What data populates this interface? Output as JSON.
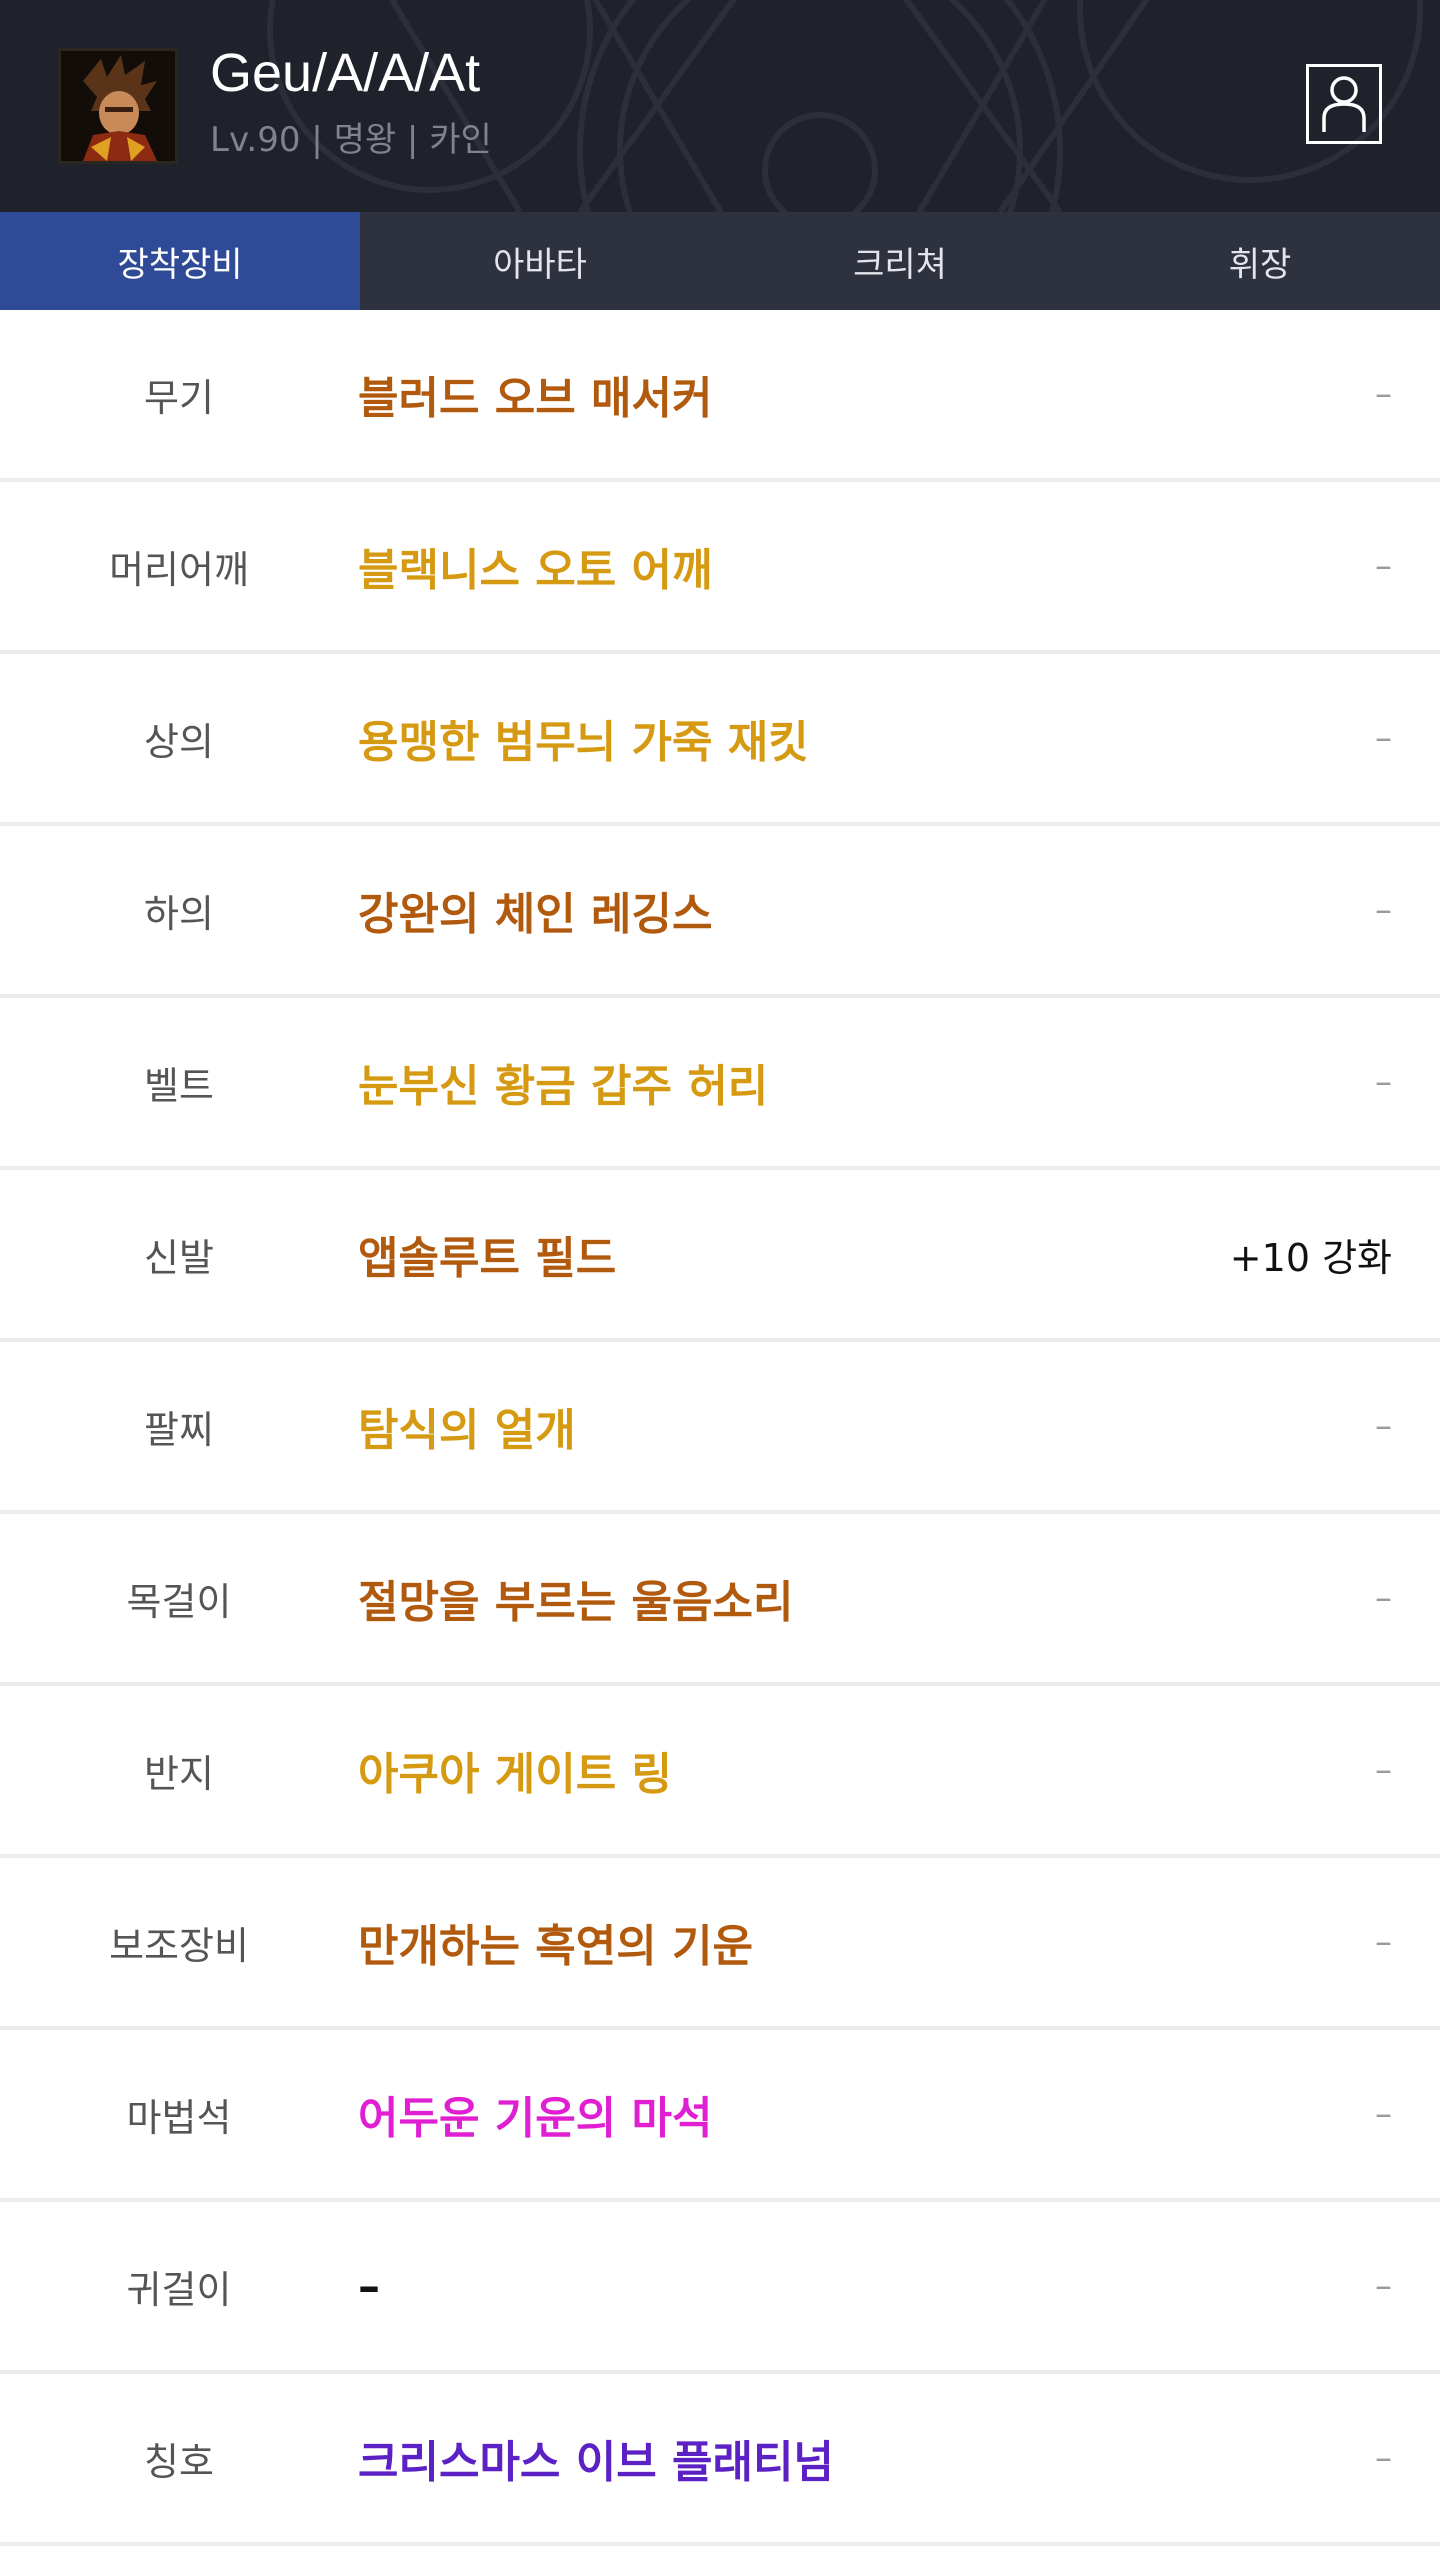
{
  "header": {
    "character_name": "Geu/A/A/At",
    "character_info": "Lv.90 | 명왕 | 카인",
    "avatar_icon": "character-portrait-icon",
    "profile_icon": "user-profile-icon"
  },
  "tabs": [
    {
      "label": "장착장비",
      "active": true
    },
    {
      "label": "아바타",
      "active": false
    },
    {
      "label": "크리쳐",
      "active": false
    },
    {
      "label": "휘장",
      "active": false
    }
  ],
  "equipment": [
    {
      "slot": "무기",
      "item": "블러드 오브 매서커",
      "color": "#b15a0e",
      "enhance": "–"
    },
    {
      "slot": "머리어깨",
      "item": "블랙니스 오토 어깨",
      "color": "#d69a12",
      "enhance": "–"
    },
    {
      "slot": "상의",
      "item": "용맹한 범무늬 가죽 재킷",
      "color": "#d69a12",
      "enhance": "–"
    },
    {
      "slot": "하의",
      "item": "강완의 체인 레깅스",
      "color": "#b15a0e",
      "enhance": "–"
    },
    {
      "slot": "벨트",
      "item": "눈부신 황금 갑주 허리",
      "color": "#d69a12",
      "enhance": "–"
    },
    {
      "slot": "신발",
      "item": "앱솔루트 필드",
      "color": "#b15a0e",
      "enhance": "+10 강화"
    },
    {
      "slot": "팔찌",
      "item": "탐식의 얼개",
      "color": "#d69a12",
      "enhance": "–"
    },
    {
      "slot": "목걸이",
      "item": "절망을 부르는 울음소리",
      "color": "#b15a0e",
      "enhance": "–"
    },
    {
      "slot": "반지",
      "item": "아쿠아 게이트 링",
      "color": "#d69a12",
      "enhance": "–"
    },
    {
      "slot": "보조장비",
      "item": "만개하는 흑연의 기운",
      "color": "#b15a0e",
      "enhance": "–"
    },
    {
      "slot": "마법석",
      "item": "어두운 기운의 마석",
      "color": "#e01fd3",
      "enhance": "–"
    },
    {
      "slot": "귀걸이",
      "item": "–",
      "color": "#111111",
      "enhance": "–"
    },
    {
      "slot": "칭호",
      "item": "크리스마스 이브 플래티넘",
      "color": "#5b21c4",
      "enhance": "–"
    }
  ]
}
